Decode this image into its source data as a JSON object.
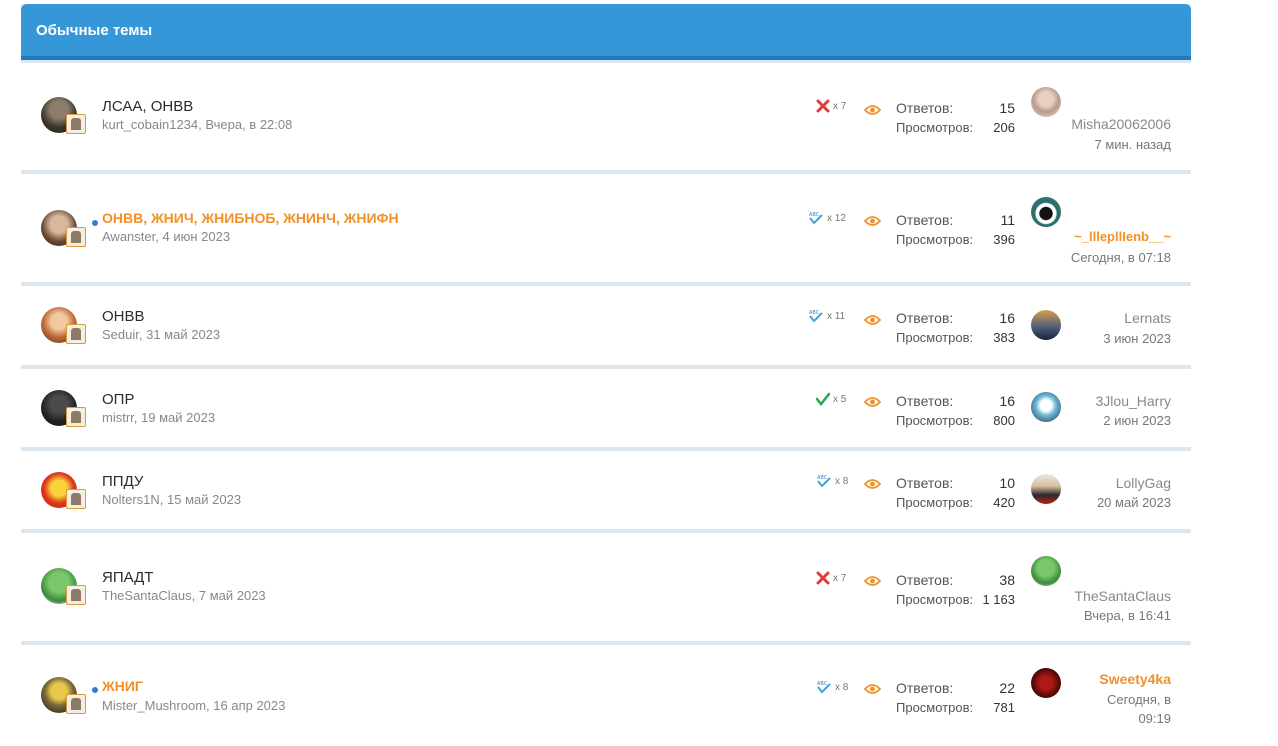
{
  "section": {
    "title": "Обычные темы"
  },
  "labels": {
    "replies": "Ответов:",
    "views": "Просмотров:"
  },
  "colors": {
    "header": "#3596d8",
    "unread_title": "#f0912a",
    "meta": "#888888"
  },
  "threads": [
    {
      "title": "ЛСАА, ОНВВ",
      "author": "kurt_cobain1234",
      "date": "Вчера, в 22:08",
      "prefix_icon": "x-icon",
      "prefix_count": "x 7",
      "replies": "15",
      "views": "206",
      "last_user": "Misha20062006",
      "last_date": "7 мин. назад",
      "unread": false
    },
    {
      "title": "ОНВВ, ЖНИЧ, ЖНИБНОБ, ЖНИНЧ, ЖНИФН",
      "author": "Awanster",
      "date": "4 июн 2023",
      "prefix_icon": "abc-check-icon",
      "prefix_count": "x 12",
      "replies": "11",
      "views": "396",
      "last_user": "~_lllepllIenb__~",
      "last_date": "Сегодня, в 07:18",
      "unread": true
    },
    {
      "title": "ОНВВ",
      "author": "Seduir",
      "date": "31 май 2023",
      "prefix_icon": "abc-check-icon",
      "prefix_count": "x 11",
      "replies": "16",
      "views": "383",
      "last_user": "Lernats",
      "last_date": "3 июн 2023",
      "unread": false
    },
    {
      "title": "ОПР",
      "author": "mistrr",
      "date": "19 май 2023",
      "prefix_icon": "check-icon",
      "prefix_count": "x 5",
      "replies": "16",
      "views": "800",
      "last_user": "3Jlou_Harry",
      "last_date": "2 июн 2023",
      "unread": false
    },
    {
      "title": "ППДУ",
      "author": "Nolters1N",
      "date": "15 май 2023",
      "prefix_icon": "abc-check-icon",
      "prefix_count": "x 8",
      "replies": "10",
      "views": "420",
      "last_user": "LollyGag",
      "last_date": "20 май 2023",
      "unread": false
    },
    {
      "title": "ЯПАДТ",
      "author": "TheSantaClaus",
      "date": "7 май 2023",
      "prefix_icon": "x-icon",
      "prefix_count": "x 7",
      "replies": "38",
      "views": "1 163",
      "last_user": "TheSantaClaus",
      "last_date": "Вчера, в 16:41",
      "unread": false
    },
    {
      "title": "ЖНИГ",
      "author": "Mister_Mushroom",
      "date": "16 апр 2023",
      "prefix_icon": "abc-check-icon",
      "prefix_count": "x 8",
      "replies": "22",
      "views": "781",
      "last_user": "Sweety4ka",
      "last_date": "Сегодня, в 09:19",
      "last_date_line1": "Сегодня, в",
      "last_date_line2": "09:19",
      "unread": true
    }
  ]
}
